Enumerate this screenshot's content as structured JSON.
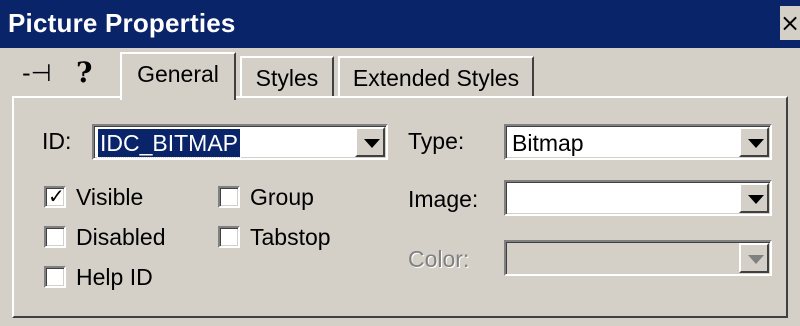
{
  "window": {
    "title": "Picture Properties",
    "close_glyph": "×"
  },
  "toolbar": {
    "pin_icon": "pushpin-icon",
    "help_icon": "help-icon",
    "pin_glyph": "-⊣",
    "help_glyph": "?"
  },
  "tabs": [
    {
      "label": "General",
      "active": true
    },
    {
      "label": "Styles",
      "active": false
    },
    {
      "label": "Extended Styles",
      "active": false
    }
  ],
  "general": {
    "id_label": "ID:",
    "id_value": "IDC_BITMAP",
    "type_label": "Type:",
    "type_value": "Bitmap",
    "image_label": "Image:",
    "image_value": "",
    "color_label": "Color:",
    "color_value": "",
    "checkboxes": {
      "visible": {
        "label": "Visible",
        "checked": true
      },
      "disabled": {
        "label": "Disabled",
        "checked": false
      },
      "help_id": {
        "label": "Help ID",
        "checked": false
      },
      "group": {
        "label": "Group",
        "checked": false
      },
      "tabstop": {
        "label": "Tabstop",
        "checked": false
      }
    },
    "check_glyph": "✓"
  },
  "colors": {
    "titlebar": "#0a246a",
    "face": "#d4d0c8",
    "selection": "#0a246a"
  }
}
